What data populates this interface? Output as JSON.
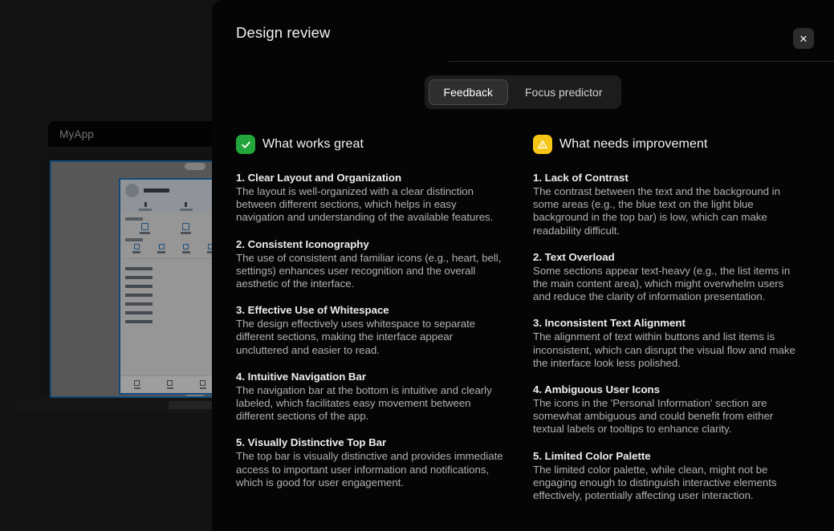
{
  "backdrop": {
    "app_title": "MyApp"
  },
  "modal": {
    "title": "Design review",
    "close_label": "✕",
    "tabs": [
      {
        "label": "Feedback",
        "active": true
      },
      {
        "label": "Focus predictor",
        "active": false
      }
    ],
    "columns": [
      {
        "icon": "check-circle-icon",
        "icon_glyph": "✓",
        "accent": "#22a53a",
        "heading": "What works great",
        "items": [
          {
            "title": "1. Clear Layout and Organization",
            "body": "The layout is well-organized with a clear distinction between different sections, which helps in easy navigation and understanding of the available features."
          },
          {
            "title": "2. Consistent Iconography",
            "body": "The use of consistent and familiar icons (e.g., heart, bell, settings) enhances user recognition and the overall aesthetic of the interface."
          },
          {
            "title": "3. Effective Use of Whitespace",
            "body": "The design effectively uses whitespace to separate different sections, making the interface appear uncluttered and easier to read."
          },
          {
            "title": "4. Intuitive Navigation Bar",
            "body": "The navigation bar at the bottom is intuitive and clearly labeled, which facilitates easy movement between different sections of the app."
          },
          {
            "title": "5. Visually Distinctive Top Bar",
            "body": "The top bar is visually distinctive and provides immediate access to important user information and notifications, which is good for user engagement."
          }
        ]
      },
      {
        "icon": "warning-triangle-icon",
        "icon_glyph": "⚠",
        "accent": "#f5c518",
        "heading": "What needs improvement",
        "items": [
          {
            "title": "1. Lack of Contrast",
            "body": "The contrast between the text and the background in some areas (e.g., the blue text on the light blue background in the top bar) is low, which can make readability difficult."
          },
          {
            "title": "2. Text Overload",
            "body": "Some sections appear text-heavy (e.g., the list items in the main content area), which might overwhelm users and reduce the clarity of information presentation."
          },
          {
            "title": "3. Inconsistent Text Alignment",
            "body": "The alignment of text within buttons and list items is inconsistent, which can disrupt the visual flow and make the interface look less polished."
          },
          {
            "title": "4. Ambiguous User Icons",
            "body": "The icons in the 'Personal Information' section are somewhat ambiguous and could benefit from either textual labels or tooltips to enhance clarity."
          },
          {
            "title": "5. Limited Color Palette",
            "body": "The limited color palette, while clean, might not be engaging enough to distinguish interactive elements effectively, potentially affecting user interaction."
          }
        ]
      }
    ]
  }
}
